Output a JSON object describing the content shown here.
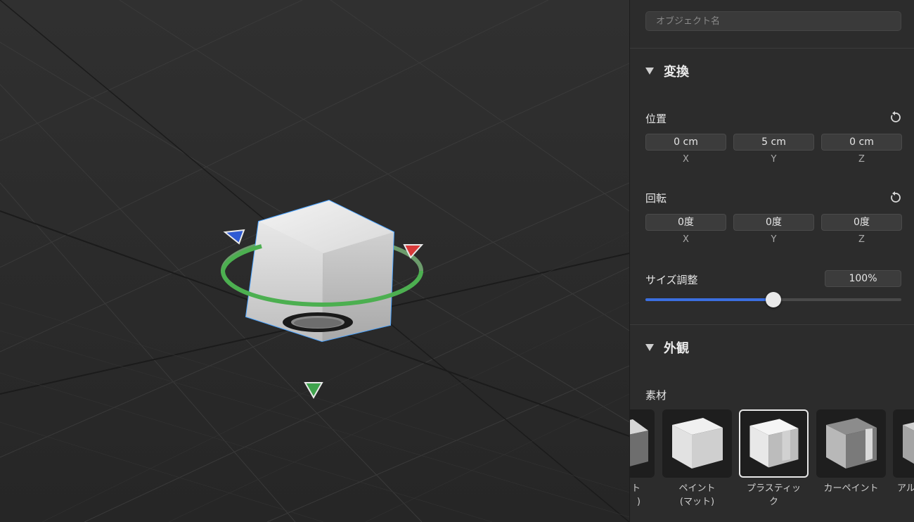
{
  "object_name": {
    "placeholder": "オブジェクト名",
    "value": ""
  },
  "transform": {
    "title": "変換",
    "position": {
      "label": "位置",
      "values": [
        "0 cm",
        "5 cm",
        "0 cm"
      ],
      "axes": [
        "X",
        "Y",
        "Z"
      ]
    },
    "rotation": {
      "label": "回転",
      "values": [
        "0度",
        "0度",
        "0度"
      ],
      "axes": [
        "X",
        "Y",
        "Z"
      ]
    },
    "scale": {
      "label": "サイズ調整",
      "value_text": "100%",
      "slider_fraction": 0.5
    }
  },
  "appearance": {
    "title": "外観",
    "material_label": "素材",
    "materials": [
      {
        "label": "ト\n)",
        "icon": "cube-dark-material-icon"
      },
      {
        "label": "ペイント\n(マット)",
        "icon": "cube-matte-paint-icon"
      },
      {
        "label": "プラスティッ\nク",
        "icon": "cube-plastic-icon",
        "selected": true
      },
      {
        "label": "カーペイント",
        "icon": "cube-car-paint-icon"
      },
      {
        "label": "アル",
        "icon": "cube-aluminum-icon"
      }
    ]
  },
  "icons": {
    "reset": "reset-icon",
    "disclosure": "disclosure-triangle-icon"
  },
  "colors": {
    "slider_accent": "#3b6fe0",
    "selection_outline": "#4aa3ff",
    "rotate_ring": "#4caf50",
    "axis_x": "#d83a3a",
    "axis_y": "#3fa34d",
    "axis_z": "#2f5bd3"
  }
}
